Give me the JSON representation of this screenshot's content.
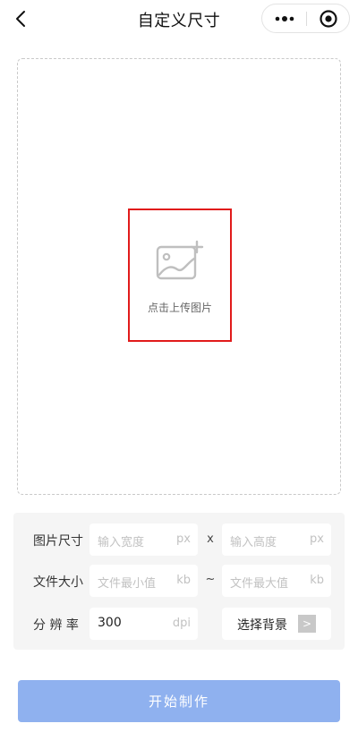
{
  "navbar": {
    "title": "自定义尺寸",
    "back_icon": "chevron-left-icon",
    "more_icon": "more-dots-icon",
    "close_icon": "target-circle-icon"
  },
  "upload": {
    "label": "点击上传图片",
    "icon": "image-add-icon",
    "highlight_color": "#e11b1b"
  },
  "settings": {
    "size": {
      "label": "图片尺寸",
      "width_placeholder": "输入宽度",
      "width_unit": "px",
      "separator": "x",
      "height_placeholder": "输入高度",
      "height_unit": "px"
    },
    "file_size": {
      "label": "文件大小",
      "min_placeholder": "文件最小值",
      "min_unit": "kb",
      "separator": "~",
      "max_placeholder": "文件最大值",
      "max_unit": "kb"
    },
    "resolution": {
      "label": "分 辨 率",
      "value": "300",
      "unit": "dpi"
    },
    "background": {
      "label": "选择背景",
      "arrow": ">"
    }
  },
  "actions": {
    "start_label": "开始制作",
    "accent_color": "#8fb1ef"
  }
}
